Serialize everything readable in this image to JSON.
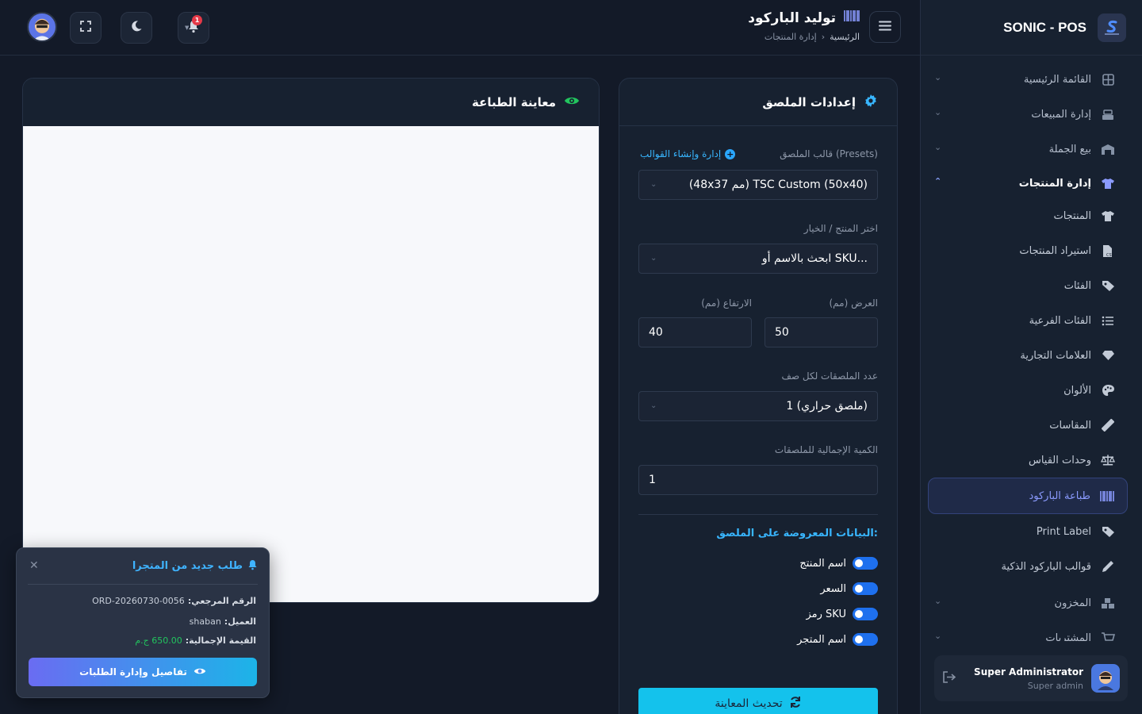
{
  "brand": {
    "name": "SONIC - POS"
  },
  "header": {
    "title": "توليد الباركود",
    "breadcrumb_home": "الرئيسية",
    "breadcrumb_sep": "›",
    "breadcrumb_current": "إدارة المنتجات",
    "notifications_count": "1"
  },
  "sidebar": {
    "items": [
      {
        "label": "القائمة الرئيسية",
        "icon": "grid-icon"
      },
      {
        "label": "إدارة المبيعات",
        "icon": "cash-register-icon"
      },
      {
        "label": "بيع الجملة",
        "icon": "warehouse-icon"
      },
      {
        "label": "إدارة المنتجات",
        "icon": "shirt-icon"
      },
      {
        "label": "المنتجات",
        "icon": "shirt-icon"
      },
      {
        "label": "استيراد المنتجات",
        "icon": "csv-file-icon"
      },
      {
        "label": "الفئات",
        "icon": "tags-icon"
      },
      {
        "label": "الفئات الفرعية",
        "icon": "list-icon"
      },
      {
        "label": "العلامات التجارية",
        "icon": "gem-icon"
      },
      {
        "label": "الألوان",
        "icon": "palette-icon"
      },
      {
        "label": "المقاسات",
        "icon": "ruler-icon"
      },
      {
        "label": "وحدات القياس",
        "icon": "scale-icon"
      },
      {
        "label": "طباعة الباركود",
        "icon": "barcode-icon"
      },
      {
        "label": "Print Label",
        "icon": "tags-icon"
      },
      {
        "label": "قوالب الباركود الذكية",
        "icon": "pen-icon"
      },
      {
        "label": "المخزون",
        "icon": "boxes-icon"
      },
      {
        "label": "المشتريات",
        "icon": "cart-icon"
      }
    ],
    "user": {
      "name": "Super Administrator",
      "role": "Super admin"
    }
  },
  "settings": {
    "title": "إعدادات الملصق",
    "preset_label": "قالب الملصق (Presets)",
    "preset_link": "إدارة وإنشاء القوالب",
    "preset_value": "(48x37 مم) TSC Custom (50x40)",
    "product_label": "اختر المنتج / الخيار",
    "product_placeholder": "ابحث بالاسم أو SKU...",
    "width_label": "العرض (مم)",
    "width_value": "50",
    "height_label": "الارتفاع (مم)",
    "height_value": "40",
    "per_row_label": "عدد الملصقات لكل صف",
    "per_row_value": "1 (ملصق حراري)",
    "qty_label": "الكمية الإجمالية للملصقات",
    "qty_value": "1",
    "display_title": "البيانات المعروضة على الملصق:",
    "toggles": [
      {
        "label": "اسم المنتج",
        "on": true
      },
      {
        "label": "السعر",
        "on": true
      },
      {
        "label": "رمز SKU",
        "on": true
      },
      {
        "label": "اسم المتجر",
        "on": true
      }
    ],
    "refresh_label": "تحديث المعاينة"
  },
  "preview": {
    "title": "معاينة الطباعة"
  },
  "toast": {
    "title": "طلب جديد من المتجرا",
    "ref_label": "الرقم المرجعي:",
    "ref_value": "ORD-20260730-0056",
    "customer_label": "العميل:",
    "customer_value": "shaban",
    "total_label": "القيمة الإجمالية:",
    "total_value": "650.00 ج.م",
    "button_label": "تفاصيل وإدارة الطلبات"
  },
  "colors": {
    "accent": "#8b9bff",
    "link": "#38b6ff",
    "primary_button": "#14c2ec",
    "toggle_on": "#1e70ee",
    "success": "#22c55e",
    "preview_eye": "#22c55e",
    "gear": "#38b6ff"
  }
}
